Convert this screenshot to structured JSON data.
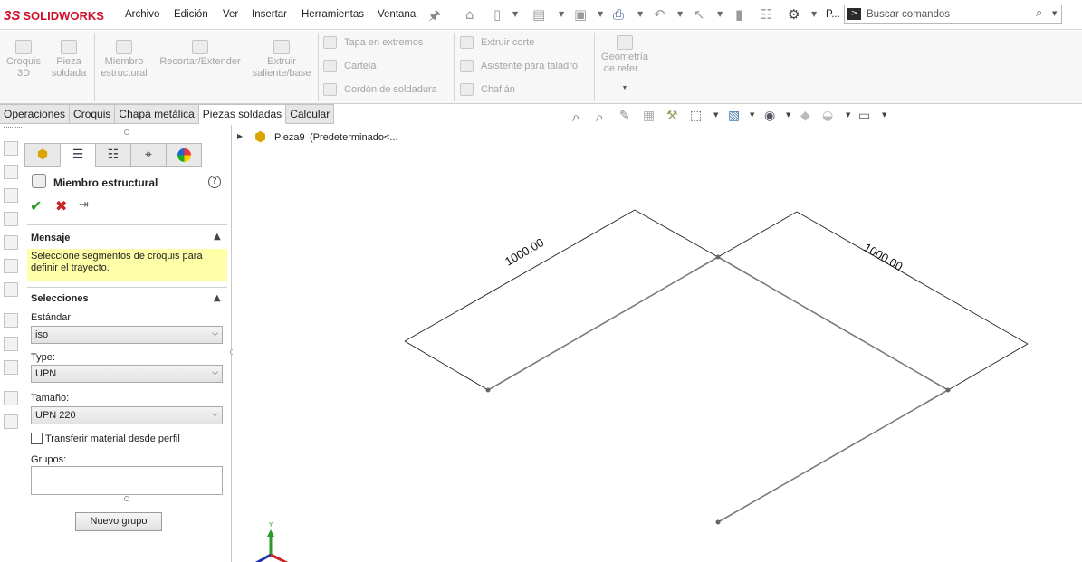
{
  "app": {
    "logo_ds": "3S",
    "logo_name": "SOLIDWORKS"
  },
  "menu": {
    "items": [
      "Archivo",
      "Edición",
      "Ver",
      "Insertar",
      "Herramientas",
      "Ventana"
    ],
    "user_initial": "P..."
  },
  "search": {
    "placeholder": "Buscar comandos",
    "icon": "search-icon"
  },
  "command_manager": {
    "sketch3d": [
      "Croquis",
      "3D"
    ],
    "weldment": [
      "Pieza",
      "soldada"
    ],
    "structural": [
      "Miembro",
      "estructural"
    ],
    "trim_extend": "Recortar/Extender",
    "boss_base": [
      "Extruir",
      "saliente/base"
    ],
    "end_cap": "Tapa en extremos",
    "gusset": "Cartela",
    "weld_bead": "Cordón de soldadura",
    "extruded_cut": "Extruir corte",
    "hole_wizard": "Asistente para taladro",
    "chamfer": "Chaflán",
    "ref_geometry": [
      "Geometría",
      "de refer..."
    ]
  },
  "tabs": [
    "Operaciones",
    "Croquis",
    "Chapa metálica",
    "Piezas soldadas",
    "Calcular"
  ],
  "active_tab": "Piezas soldadas",
  "property_manager": {
    "title": "Miembro estructural",
    "help": "?",
    "message_header": "Mensaje",
    "message_text": "Seleccione segmentos de croquis para definir el trayecto.",
    "selections_header": "Selecciones",
    "standard_label": "Estándar:",
    "standard_value": "iso",
    "type_label": "Type:",
    "type_value": "UPN",
    "size_label": "Tamaño:",
    "size_value": "UPN 220",
    "transfer_label": "Transferir material desde perfil",
    "transfer_checked": false,
    "groups_label": "Grupos:",
    "new_group_button": "Nuevo grupo"
  },
  "tree": {
    "part_name": "Pieza9",
    "config": "(Predeterminado<..."
  },
  "sketch": {
    "dimension_left": "1000.00",
    "dimension_right": "1000.00",
    "axis_y_label": "Y"
  },
  "colors": {
    "brand": "#d0102a",
    "message_bg": "#ffffa8",
    "accept": "#2e9a2e",
    "cancel": "#cc2222"
  }
}
